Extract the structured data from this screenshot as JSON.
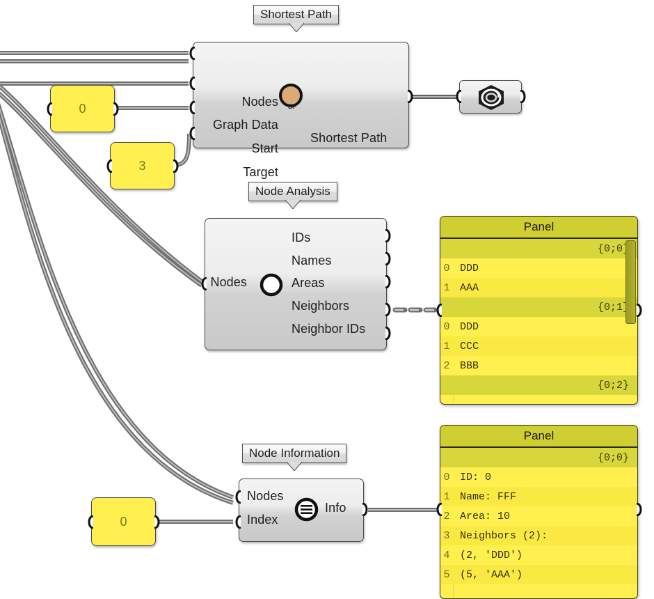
{
  "canvas": {
    "background": "#ffffff",
    "wire_color": "#777777",
    "component_accent": "#d8d8d8",
    "param_yellow": "#ffef4f",
    "panel_header": "#cfcf33"
  },
  "components": {
    "shortest_path": {
      "callout": "Shortest Path",
      "icon": "shortest-path-icon",
      "icon_tag": "SP",
      "icon_color": "#dbaa77",
      "inputs": [
        "Nodes",
        "Graph Data",
        "Start",
        "Target"
      ],
      "outputs": [
        "Shortest Path"
      ]
    },
    "node_analysis": {
      "callout": "Node Analysis",
      "icon": "node-analysis-icon",
      "inputs": [
        "Nodes"
      ],
      "outputs": [
        "IDs",
        "Names",
        "Areas",
        "Neighbors",
        "Neighbor IDs"
      ]
    },
    "node_information": {
      "callout": "Node Information",
      "icon": "node-information-icon",
      "inputs": [
        "Nodes",
        "Index"
      ],
      "outputs": [
        "Info"
      ]
    },
    "geometry_param": {
      "icon": "hex-nut-geometry-icon"
    }
  },
  "params": {
    "start_value": "0",
    "target_value": "3",
    "index_value": "0"
  },
  "panels": [
    {
      "title": "Panel",
      "rows": [
        {
          "kind": "path",
          "text": "{0;0}"
        },
        {
          "kind": "item",
          "index": "0",
          "value": "DDD"
        },
        {
          "kind": "item",
          "index": "1",
          "value": "AAA"
        },
        {
          "kind": "path",
          "text": "{0;1}"
        },
        {
          "kind": "item",
          "index": "0",
          "value": "DDD"
        },
        {
          "kind": "item",
          "index": "1",
          "value": "CCC"
        },
        {
          "kind": "item",
          "index": "2",
          "value": "BBB"
        },
        {
          "kind": "path",
          "text": "{0;2}"
        }
      ]
    },
    {
      "title": "Panel",
      "rows": [
        {
          "kind": "path",
          "text": "{0;0}"
        },
        {
          "kind": "item",
          "index": "0",
          "value": "ID: 0"
        },
        {
          "kind": "item",
          "index": "1",
          "value": "Name: FFF"
        },
        {
          "kind": "item",
          "index": "2",
          "value": "Area: 10"
        },
        {
          "kind": "item",
          "index": "3",
          "value": "Neighbors (2):"
        },
        {
          "kind": "item",
          "index": "4",
          "value": "(2, 'DDD')"
        },
        {
          "kind": "item",
          "index": "5",
          "value": "(5, 'AAA')"
        }
      ]
    }
  ]
}
